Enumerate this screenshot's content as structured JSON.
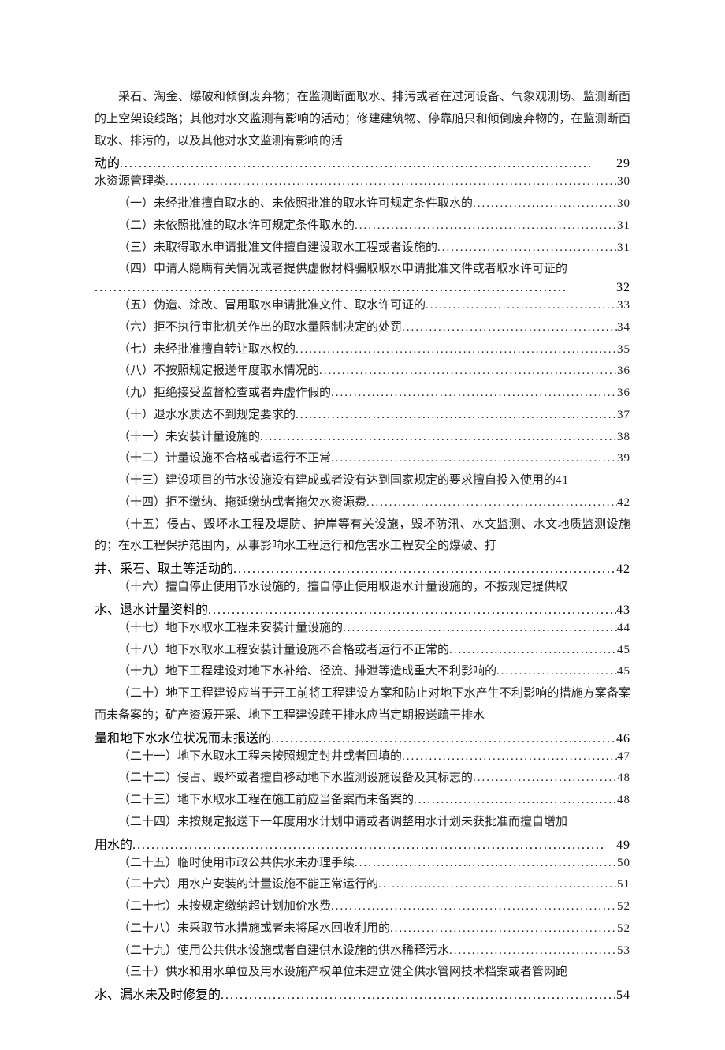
{
  "prelude": {
    "body": "采石、淘金、爆破和倾倒废弃物；在监测断面取水、排污或者在过河设备、气象观测场、监测断面的上空架设线路；其他对水文监测有影响的活动；修建建筑物、停靠船只和倾倒废弃物的，在监测断面取水、排污的，以及其他对水文监测有影响的活",
    "tail": "动的",
    "page": "29"
  },
  "section": {
    "title": "水资源管理类",
    "page": "30"
  },
  "items": [
    {
      "label": "（一）未经批准擅自取水的、未依照批准的取水许可规定条件取水的",
      "page": "30"
    },
    {
      "label": "（二）未依照批准的取水许可规定条件取水的",
      "page": "31"
    },
    {
      "label": "（三）未取得取水申请批准文件擅自建设取水工程或者设施的",
      "page": "31"
    },
    {
      "wrap": true,
      "body": "（四）申请人隐瞒有关情况或者提供虚假材料骗取取水申请批准文件或者取水许可证的",
      "tail": "",
      "page": "32"
    },
    {
      "label": "（五）伪造、涂改、冒用取水申请批准文件、取水许可证的",
      "page": "33"
    },
    {
      "label": "（六）拒不执行审批机关作出的取水量限制决定的处罚",
      "page": "34"
    },
    {
      "label": "（七）未经批准擅自转让取水权的",
      "page": "35"
    },
    {
      "label": "（八）不按照规定报送年度取水情况的",
      "page": "36"
    },
    {
      "label": "（九）拒绝接受监督检查或者弄虚作假的",
      "page": "36"
    },
    {
      "label": "（十）退水水质达不到规定要求的",
      "page": "37"
    },
    {
      "label": "（十一）未安装计量设施的",
      "page": "38"
    },
    {
      "label": "（十二）计量设施不合格或者运行不正常",
      "page": "39"
    },
    {
      "label": "（十三）建设项目的节水设施没有建成或者没有达到国家规定的要求擅自投入使用的",
      "page": "41",
      "tight": true
    },
    {
      "label": "（十四）拒不缴纳、拖延缴纳或者拖欠水资源费",
      "page": "42"
    },
    {
      "wrap": true,
      "body": "（十五）侵占、毁坏水工程及堤防、护岸等有关设施，毁坏防汛、水文监测、水文地质监测设施的；在水工程保护范围内，从事影响水工程运行和危害水工程安全的爆破、打",
      "tail": "井、采石、取土等活动的",
      "page": "42"
    },
    {
      "wrap": true,
      "body": "（十六）擅自停止使用节水设施的，擅自停止使用取退水计量设施的，不按规定提供取",
      "tail": "水、退水计量资料的",
      "page": "43"
    },
    {
      "label": "（十七）地下水取水工程未安装计量设施的",
      "page": "44"
    },
    {
      "label": "（十八）地下水取水工程安装计量设施不合格或者运行不正常的",
      "page": "45"
    },
    {
      "label": "（十九）地下工程建设对地下水补给、径流、排泄等造成重大不利影响的",
      "page": "45"
    },
    {
      "wrap": true,
      "body": "（二十）地下工程建设应当于开工前将工程建设方案和防止对地下水产生不利影响的措施方案备案而未备案的；矿产资源开采、地下工程建设疏干排水应当定期报送疏干排水",
      "tail": "量和地下水水位状况而未报送的",
      "page": "46"
    },
    {
      "label": "（二十一）地下水取水工程未按照规定封井或者回填的",
      "page": "47"
    },
    {
      "label": "（二十二）侵占、毁坏或者擅自移动地下水监测设施设备及其标志的",
      "page": "48"
    },
    {
      "label": "（二十三）地下水取水工程在施工前应当备案而未备案的",
      "page": "48"
    },
    {
      "wrap": true,
      "body": "（二十四）未按规定报送下一年度用水计划申请或者调整用水计划未获批准而擅自增加",
      "tail": "用水的",
      "page": "49"
    },
    {
      "label": "（二十五）临时使用市政公共供水未办理手续",
      "page": "50"
    },
    {
      "label": "（二十六）用水户安装的计量设施不能正常运行的",
      "page": "51"
    },
    {
      "label": "（二十七）未按规定缴纳超计划加价水费",
      "page": "52"
    },
    {
      "label": "（二十八）未采取节水措施或者未将尾水回收利用的",
      "page": "52"
    },
    {
      "label": "（二十九）使用公共供水设施或者自建供水设施的供水稀释污水",
      "page": "53"
    },
    {
      "wrap": true,
      "body": "（三十）供水和用水单位及用水设施产权单位未建立健全供水管网技术档案或者管网跑",
      "tail": "水、漏水未及时修复的",
      "page": "54"
    }
  ]
}
